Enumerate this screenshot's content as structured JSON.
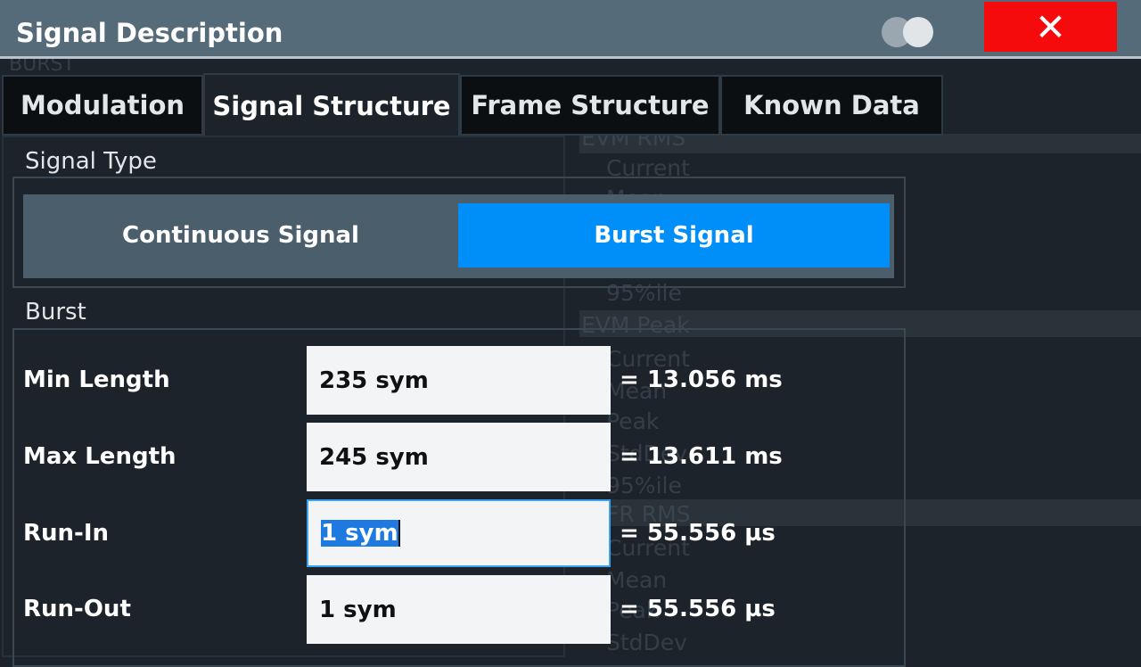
{
  "dialog": {
    "title": "Signal Description",
    "close_label": "✕",
    "toggle_icon": "overlay-toggle-icon",
    "close_color": "#f50b0b"
  },
  "background_text": [
    "BURST",
    "EVM RMS",
    "Current",
    "Mean",
    "95%ile",
    "EVM Peak",
    "Current",
    "Mean",
    "Peak",
    "StdDev",
    "95%ile",
    "FR RMS",
    "Current",
    "Mean",
    "Peak",
    "StdDev"
  ],
  "tabs": [
    {
      "label": "Modulation",
      "active": false
    },
    {
      "label": "Signal Structure",
      "active": true
    },
    {
      "label": "Frame Structure",
      "active": false
    },
    {
      "label": "Known Data",
      "active": false
    }
  ],
  "signal_type": {
    "label": "Signal Type",
    "options": [
      "Continuous Signal",
      "Burst Signal"
    ],
    "selected": "Burst Signal",
    "accent": "#008ff9"
  },
  "burst": {
    "label": "Burst",
    "rows": [
      {
        "label": "Min Length",
        "value": "235 sym",
        "result": "= 13.056 ms"
      },
      {
        "label": "Max Length",
        "value": "245 sym",
        "result": "= 13.611 ms"
      },
      {
        "label": "Run-In",
        "value": "1 sym",
        "result": "= 55.556 µs",
        "focused": true
      },
      {
        "label": "Run-Out",
        "value": "1 sym",
        "result": "= 55.556 µs"
      }
    ]
  }
}
